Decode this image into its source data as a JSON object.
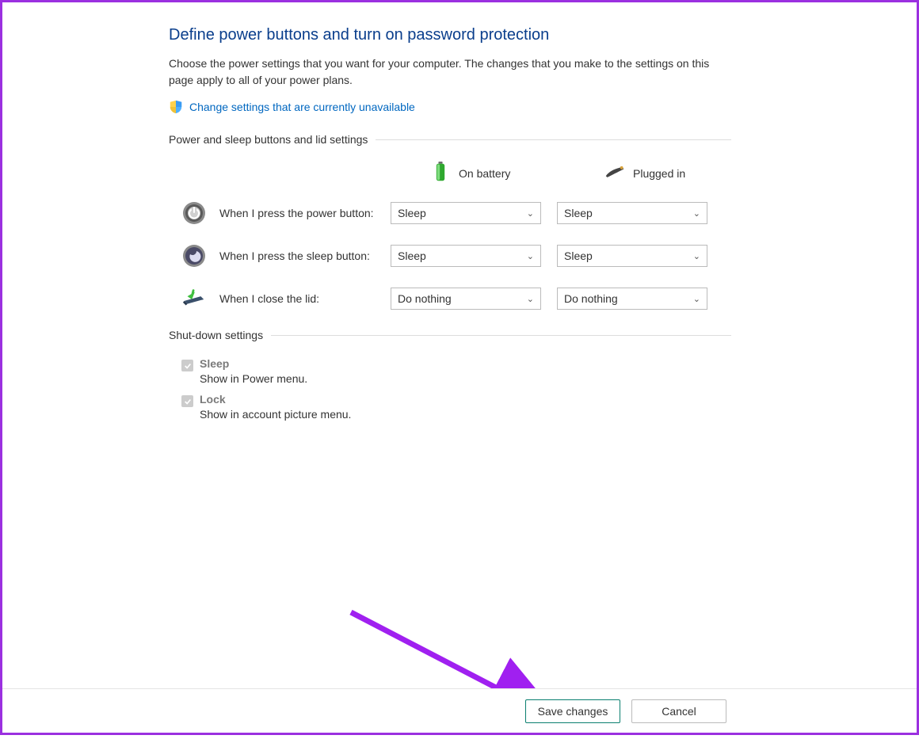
{
  "header": {
    "title": "Define power buttons and turn on password protection",
    "description": "Choose the power settings that you want for your computer. The changes that you make to the settings on this page apply to all of your power plans.",
    "change_link": "Change settings that are currently unavailable"
  },
  "sections": {
    "power_sleep": {
      "label": "Power and sleep buttons and lid settings",
      "columns": {
        "battery": "On battery",
        "plugged": "Plugged in"
      },
      "rows": [
        {
          "label": "When I press the power button:",
          "battery_value": "Sleep",
          "plugged_value": "Sleep"
        },
        {
          "label": "When I press the sleep button:",
          "battery_value": "Sleep",
          "plugged_value": "Sleep"
        },
        {
          "label": "When I close the lid:",
          "battery_value": "Do nothing",
          "plugged_value": "Do nothing"
        }
      ]
    },
    "shutdown": {
      "label": "Shut-down settings",
      "items": [
        {
          "title": "Sleep",
          "desc": "Show in Power menu."
        },
        {
          "title": "Lock",
          "desc": "Show in account picture menu."
        }
      ]
    }
  },
  "footer": {
    "save": "Save changes",
    "cancel": "Cancel"
  }
}
